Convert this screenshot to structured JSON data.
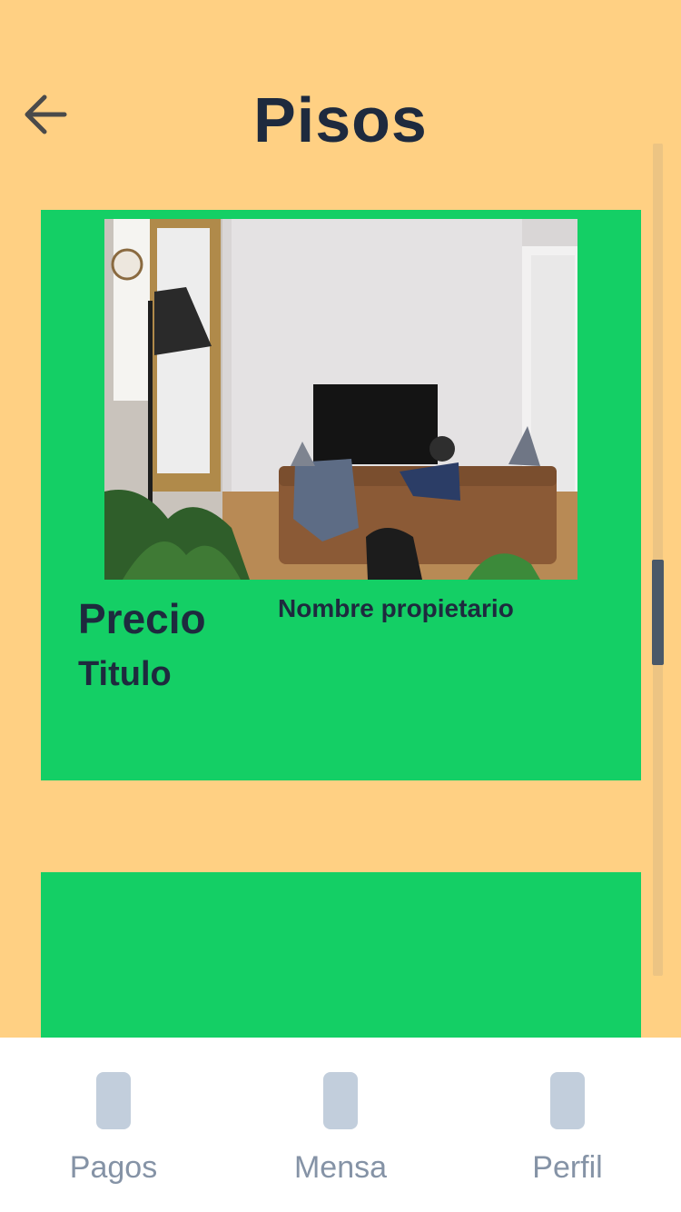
{
  "header": {
    "title": "Pisos",
    "back_icon": "arrow-left-icon"
  },
  "listings": [
    {
      "price": "Precio",
      "title": "Titulo",
      "owner": "Nombre propietario",
      "image": "living-room-photo",
      "background": "#14CF65"
    },
    {
      "price": "",
      "title": "",
      "owner": "",
      "background": "#14CF65"
    }
  ],
  "tabbar": {
    "items": [
      {
        "label": "Pagos",
        "icon": "payments-icon"
      },
      {
        "label": "Mensa",
        "icon": "messages-icon"
      },
      {
        "label": "Perfil",
        "icon": "profile-icon"
      }
    ]
  },
  "colors": {
    "background": "#FFD083",
    "card": "#14CF65",
    "text": "#1E2A3E",
    "tab_icon": "#C2CEDC",
    "tab_label": "#8593A6"
  }
}
